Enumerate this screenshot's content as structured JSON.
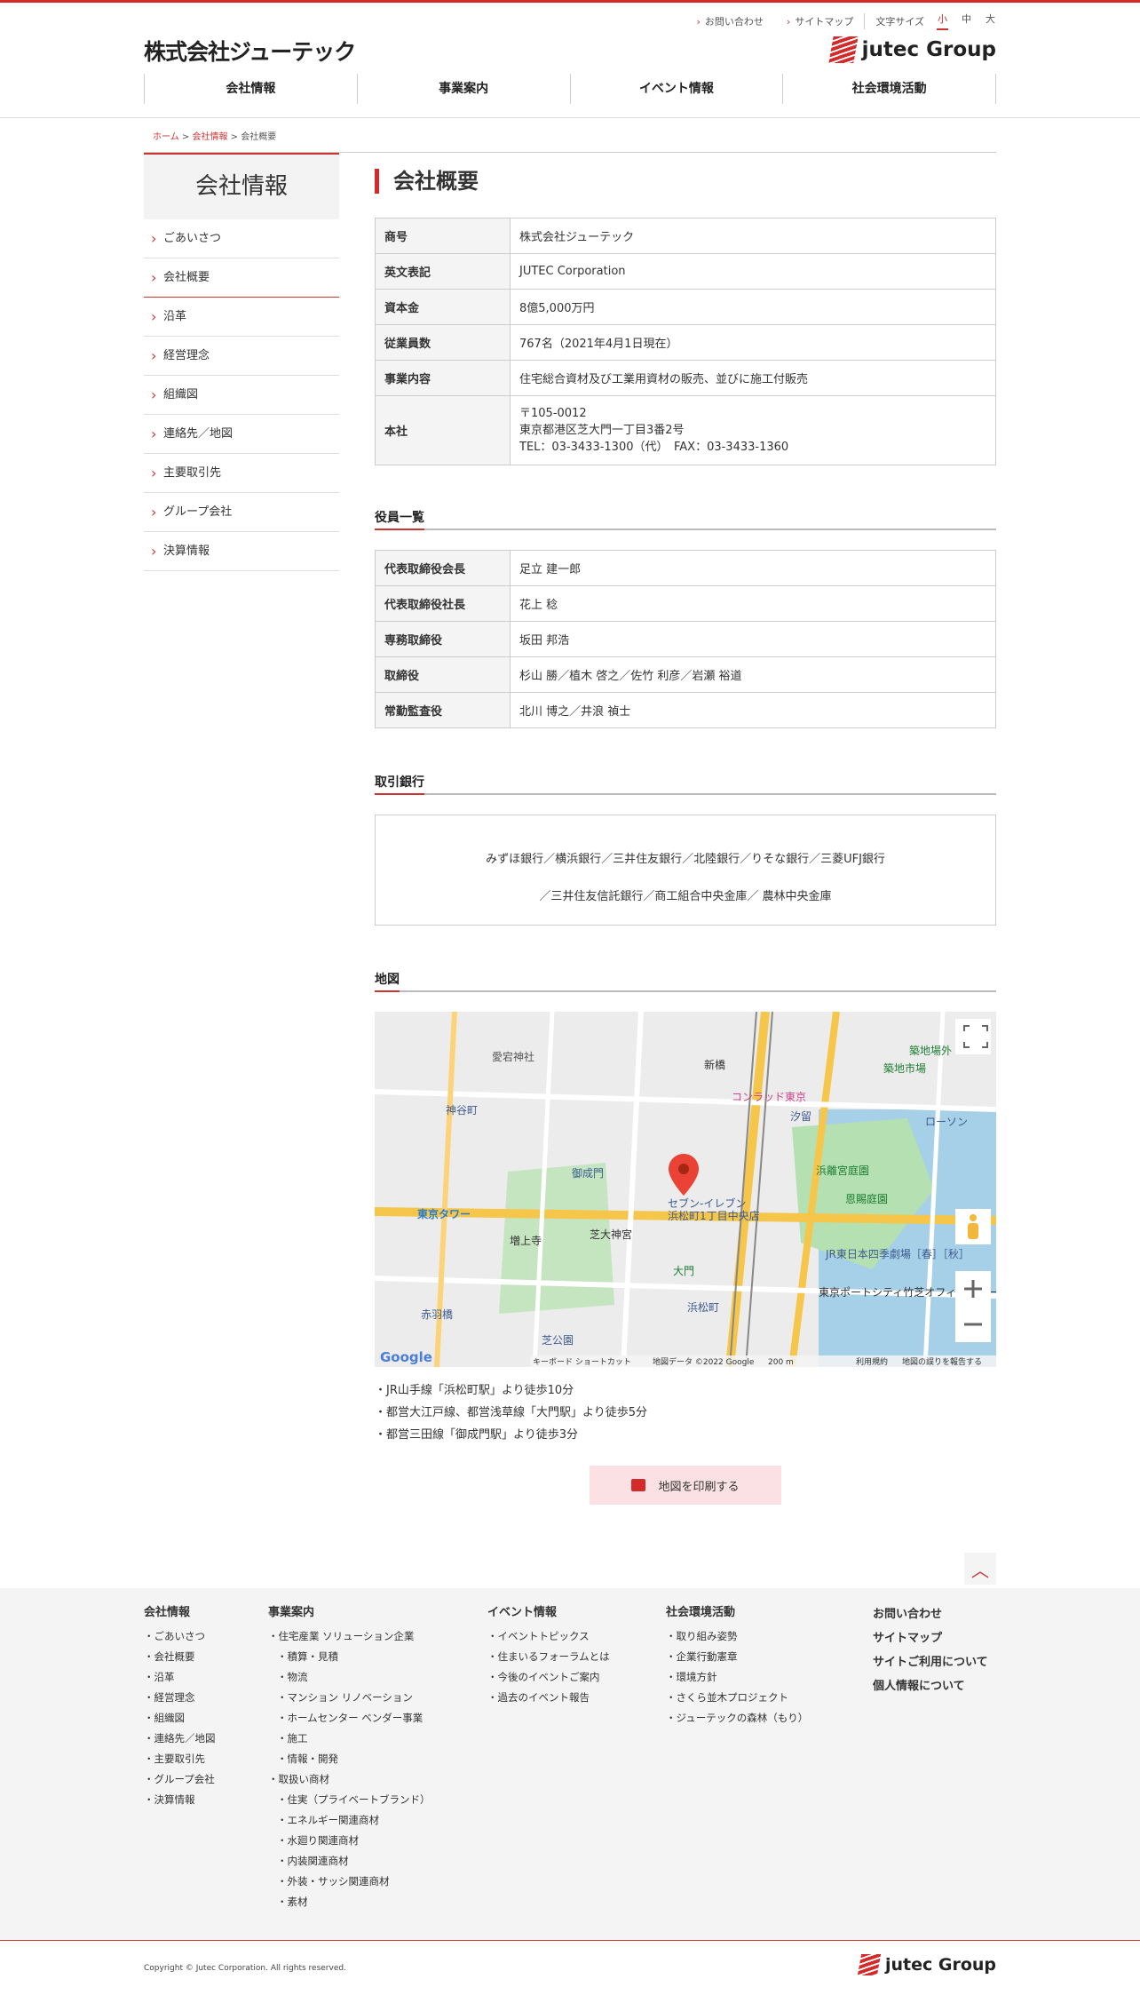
{
  "header": {
    "logo": "株式会社ジューテック",
    "toplinks": [
      "お問い合わせ",
      "サイトマップ"
    ],
    "font_size_label": "文字サイズ",
    "font_sizes": [
      "小",
      "中",
      "大"
    ],
    "group_logo": "jutec Group"
  },
  "nav": [
    "会社情報",
    "事業案内",
    "イベント情報",
    "社会環境活動"
  ],
  "breadcrumb": {
    "home": "ホーム",
    "parent": "会社情報",
    "current": "会社概要",
    "sep": " > "
  },
  "sidebar": {
    "title": "会社情報",
    "items": [
      "ごあいさつ",
      "会社概要",
      "沿革",
      "経営理念",
      "組織図",
      "連絡先／地図",
      "主要取引先",
      "グループ会社",
      "決算情報"
    ]
  },
  "page_title": "会社概要",
  "company": [
    {
      "label": "商号",
      "value": "株式会社ジューテック"
    },
    {
      "label": "英文表記",
      "value": "JUTEC Corporation"
    },
    {
      "label": "資本金",
      "value": "8億5,000万円"
    },
    {
      "label": "従業員数",
      "value": "767名（2021年4月1日現在）"
    },
    {
      "label": "事業内容",
      "value": "住宅総合資材及び工業用資材の販売、並びに施工付販売"
    },
    {
      "label": "本社",
      "lines": [
        "〒105-0012",
        "東京都港区芝大門一丁目3番2号",
        "TEL：03-3433-1300（代）　FAX：03-3433-1360"
      ]
    }
  ],
  "officers_title": "役員一覧",
  "officers": [
    {
      "label": "代表取締役会長",
      "value": "足立 建一郎"
    },
    {
      "label": "代表取締役社長",
      "value": "花上 稔"
    },
    {
      "label": "専務取締役",
      "value": "坂田 邦浩"
    },
    {
      "label": "取締役",
      "value": "杉山 勝／植木 啓之／佐竹 利彦／岩瀬 裕道"
    },
    {
      "label": "常勤監査役",
      "value": "北川 博之／井浪 禎士"
    }
  ],
  "banks_title": "取引銀行",
  "banks": [
    "みずほ銀行／横浜銀行／三井住友銀行／北陸銀行／りそな銀行／三菱UFJ銀行",
    "／三井住友信託銀行／商工組合中央金庫／ 農林中央金庫"
  ],
  "map_title": "地図",
  "map_labels": [
    "愛宕神社",
    "新橋",
    "神谷町",
    "コンラッド東京",
    "汐留",
    "築地場外",
    "築地市場",
    "浜離宮庭園",
    "恩賜庭園",
    "東京タワー",
    "芝大神宮",
    "増上寺",
    "セブン-イレブン",
    "浜松町1丁目中央店",
    "大門",
    "浜松町",
    "JR東日本四季劇場［春］［秋］",
    "東京ポートシティ竹芝オフィスタワー",
    "御成門",
    "赤羽橋",
    "芝公園",
    "ローソン",
    "汐留",
    "キーボード ショートカット",
    "地図データ ©2022 Google",
    "200 m",
    "利用規約",
    "地図の誤りを報告する",
    "Google"
  ],
  "access": [
    "・JR山手線「浜松町駅」より徒歩10分",
    "・都営大江戸線、都営浅草線「大門駅」より徒歩5分",
    "・都営三田線「御成門駅」より徒歩3分"
  ],
  "print_label": "地図を印刷する",
  "pagetop": "︿",
  "footer": {
    "col1": {
      "title": "会社情報",
      "items": [
        "ごあいさつ",
        "会社概要",
        "沿革",
        "経営理念",
        "組織図",
        "連絡先／地図",
        "主要取引先",
        "グループ会社",
        "決算情報"
      ]
    },
    "col2": {
      "title": "事業案内",
      "items": [
        "住宅産業 ソリューション企業",
        "積算・見積",
        "物流",
        "マンション リノベーション",
        "ホームセンター ベンダー事業",
        "施工",
        "情報・開発",
        "取扱い商材",
        "住実（プライベートブランド）",
        "エネルギー関連商材",
        "水廻り関連商材",
        "内装関連商材",
        "外装・サッシ関連商材",
        "素材"
      ]
    },
    "col3": {
      "title": "イベント情報",
      "items": [
        "イベントトピックス",
        "住まいるフォーラムとは",
        "今後のイベントご案内",
        "過去のイベント報告"
      ]
    },
    "col4": {
      "title": "社会環境活動",
      "items": [
        "取り組み姿勢",
        "企業行動憲章",
        "環境方針",
        "さくら並木プロジェクト",
        "ジューテックの森林（もり）"
      ]
    },
    "col5": [
      "お問い合わせ",
      "サイトマップ",
      "サイトご利用について",
      "個人情報について"
    ]
  },
  "copyright": "Copyright © Jutec Corporation. All rights reserved.",
  "colors": {
    "accent": "#d42a2a",
    "print_bg": "#fbe1e3",
    "footer_bg": "#f4f4f4"
  }
}
